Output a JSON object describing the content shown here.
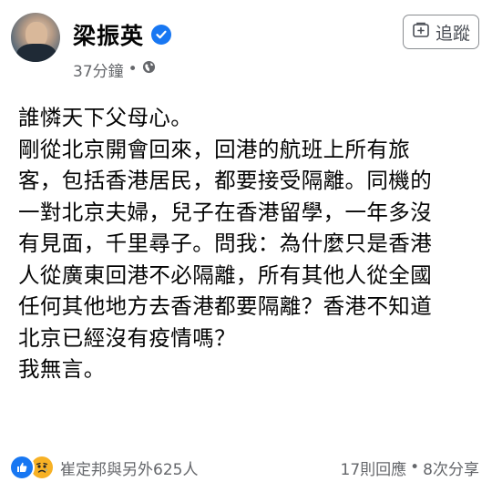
{
  "author": {
    "name": "梁振英",
    "verified_icon": "verified-badge-icon",
    "avatar_icon": "profile-avatar"
  },
  "meta": {
    "time": "37分鐘",
    "separator": "•",
    "privacy_icon": "globe-icon"
  },
  "follow_button": {
    "label": "追蹤",
    "icon": "follow-icon"
  },
  "post": {
    "lines": [
      "誰憐天下父母心。",
      "剛從北京開會回來，回港的航班上所有旅",
      "客，包括香港居民，都要接受隔離。同機的",
      "一對北京夫婦，兒子在香港留學，一年多沒",
      "有見面，千里尋子。問我：為什麼只是香港",
      "人從廣東回港不必隔離，所有其他人從全國",
      "任何其他地方去香港都要隔離？香港不知道",
      "北京已經沒有疫情嗎？",
      "我無言。"
    ]
  },
  "footer": {
    "reactions_text": "崔定邦與另外625人",
    "reaction_icons": [
      "like-icon",
      "sad-icon"
    ],
    "comments": "17則回應",
    "separator": "•",
    "shares": "8次分享"
  },
  "colors": {
    "accent": "#1877f2",
    "text": "#050505",
    "secondary": "#65676b",
    "sad": "#f7b125"
  }
}
